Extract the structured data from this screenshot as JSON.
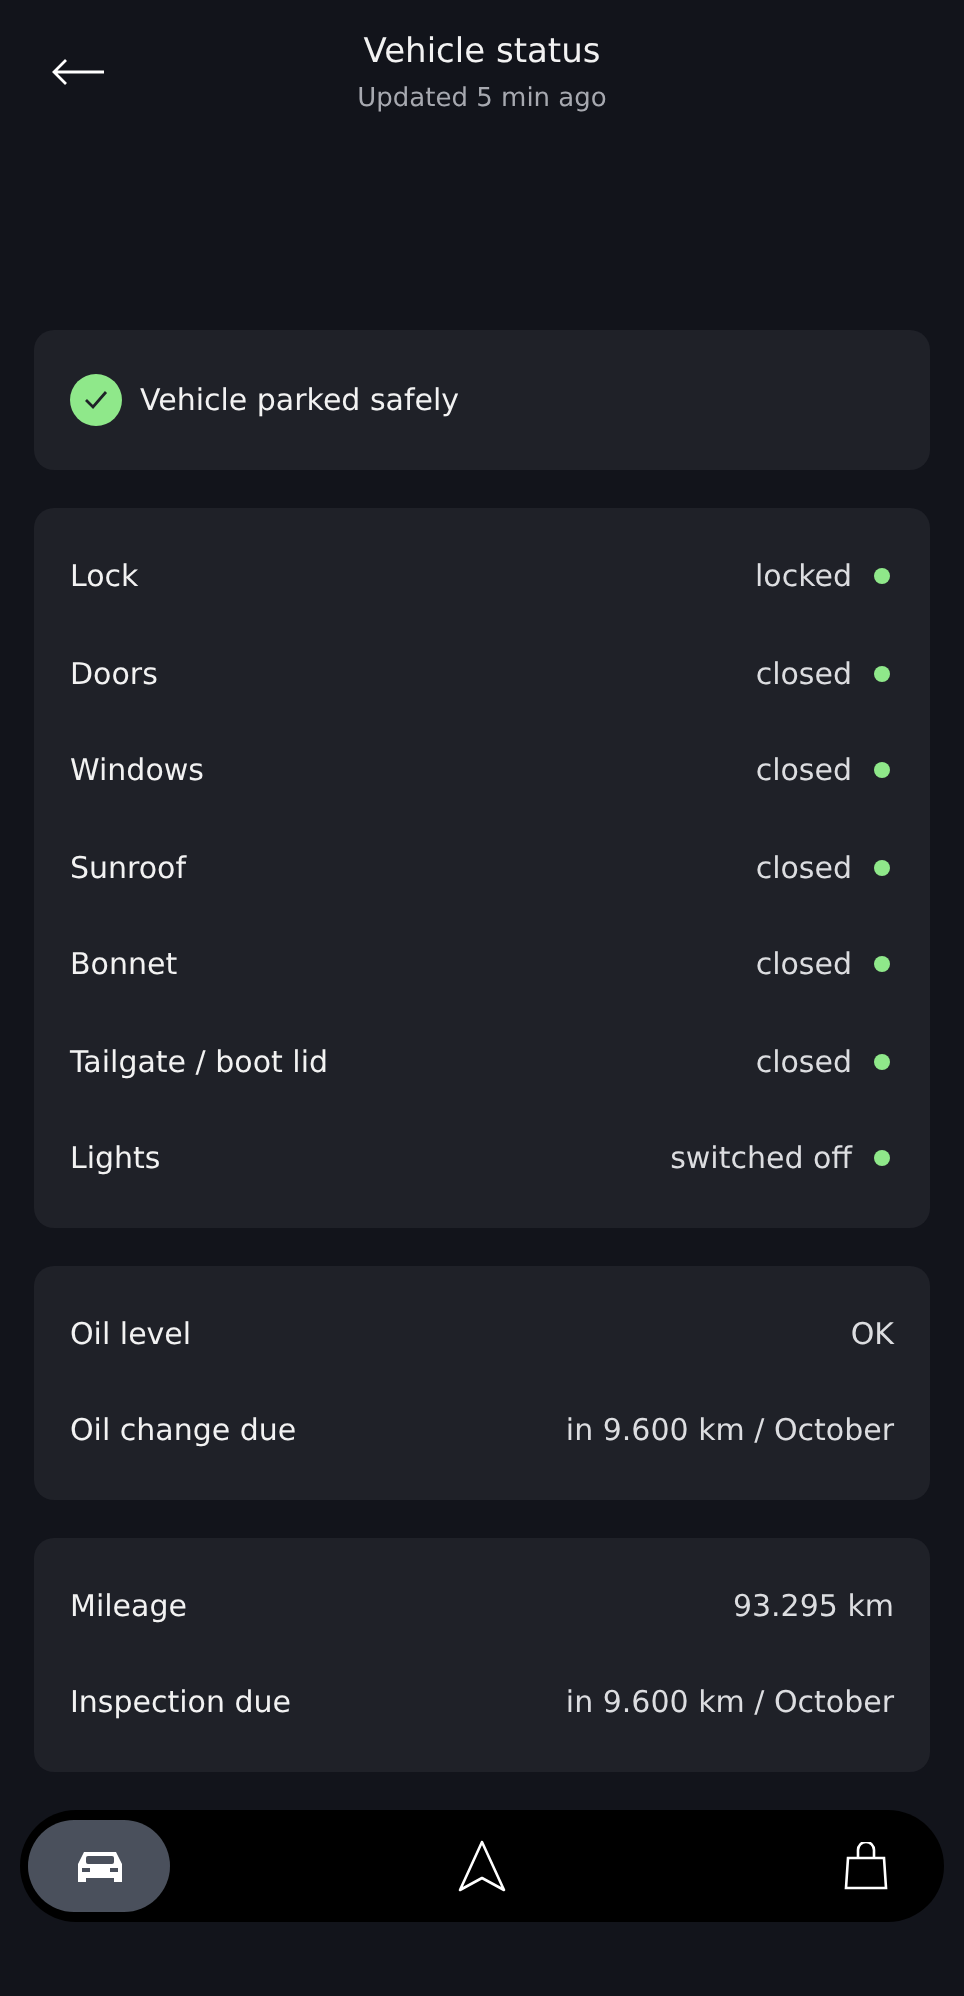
{
  "header": {
    "title": "Vehicle status",
    "subtitle": "Updated 5 min ago"
  },
  "summary": {
    "text": "Vehicle parked safely",
    "checked": true
  },
  "groups": [
    {
      "rows": [
        {
          "label": "Lock",
          "value": "locked",
          "color": "#8fe88a"
        },
        {
          "label": "Doors",
          "value": "closed",
          "color": "#8fe88a"
        },
        {
          "label": "Windows",
          "value": "closed",
          "color": "#8fe88a"
        },
        {
          "label": "Sunroof",
          "value": "closed",
          "color": "#8fe88a"
        },
        {
          "label": "Bonnet",
          "value": "closed",
          "color": "#8fe88a"
        },
        {
          "label": "Tailgate / boot lid",
          "value": "closed",
          "color": "#8fe88a"
        },
        {
          "label": "Lights",
          "value": "switched off",
          "color": "#8fe88a"
        }
      ]
    },
    {
      "rows": [
        {
          "label": "Oil level",
          "value": "OK"
        },
        {
          "label": "Oil change due",
          "value": "in 9.600 km / October"
        }
      ]
    },
    {
      "rows": [
        {
          "label": "Mileage",
          "value": "93.295 km"
        },
        {
          "label": "Inspection due",
          "value": "in 9.600 km / October"
        }
      ]
    }
  ],
  "nav": [
    {
      "kind": "car",
      "selected": true
    },
    {
      "kind": "navigate",
      "selected": false
    },
    {
      "kind": "shop",
      "selected": false
    }
  ]
}
